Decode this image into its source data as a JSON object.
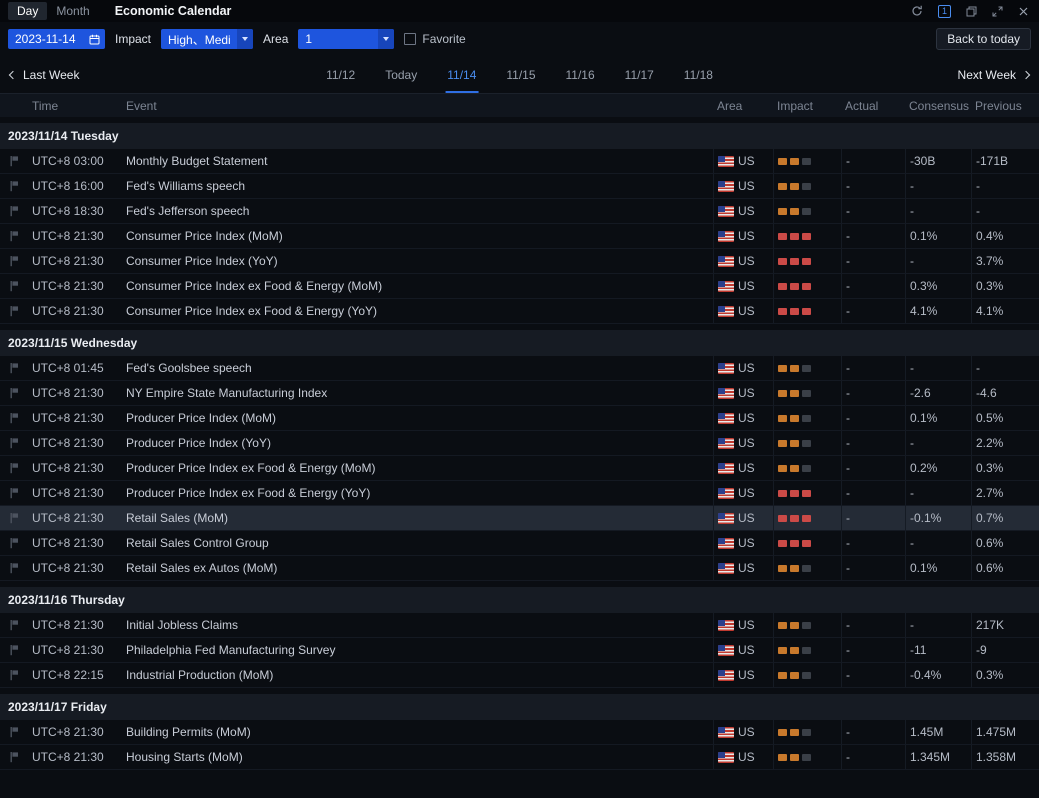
{
  "colors": {
    "accent_blue": "#1e55de",
    "active_tab_blue": "#4a8df0",
    "impact_medium": "#c8792c",
    "impact_high": "#cb4a47",
    "highlight_row": "#242b36"
  },
  "titlebar": {
    "day_tab": "Day",
    "month_tab": "Month",
    "title": "Economic Calendar",
    "panel_count": "1",
    "icons": [
      "refresh-icon",
      "panel-count-badge",
      "restore-icon",
      "expand-icon",
      "close-icon"
    ]
  },
  "filters": {
    "date_value": "2023-11-14",
    "impact_label": "Impact",
    "impact_value": "High、Medi",
    "area_label": "Area",
    "area_value": "1",
    "favorite_label": "Favorite",
    "back_to_today_label": "Back to today"
  },
  "weeknav": {
    "last_week_label": "Last Week",
    "next_week_label": "Next Week",
    "days": [
      {
        "label": "11/12",
        "active": false
      },
      {
        "label": "Today",
        "active": false
      },
      {
        "label": "11/14",
        "active": true
      },
      {
        "label": "11/15",
        "active": false
      },
      {
        "label": "11/16",
        "active": false
      },
      {
        "label": "11/17",
        "active": false
      },
      {
        "label": "11/18",
        "active": false
      }
    ]
  },
  "table": {
    "headers": {
      "time": "Time",
      "event": "Event",
      "area": "Area",
      "impact": "Impact",
      "actual": "Actual",
      "consensus": "Consensus",
      "previous": "Previous"
    },
    "sections": [
      {
        "date_label": "2023/11/14 Tuesday",
        "rows": [
          {
            "time": "UTC+8 03:00",
            "event": "Monthly Budget Statement",
            "area": "US",
            "impact": "medium",
            "actual": "-",
            "consensus": "-30B",
            "previous": "-171B"
          },
          {
            "time": "UTC+8 16:00",
            "event": "Fed's Williams speech",
            "area": "US",
            "impact": "medium",
            "actual": "-",
            "consensus": "-",
            "previous": "-"
          },
          {
            "time": "UTC+8 18:30",
            "event": "Fed's Jefferson speech",
            "area": "US",
            "impact": "medium",
            "actual": "-",
            "consensus": "-",
            "previous": "-"
          },
          {
            "time": "UTC+8 21:30",
            "event": "Consumer Price Index (MoM)",
            "area": "US",
            "impact": "high",
            "actual": "-",
            "consensus": "0.1%",
            "previous": "0.4%"
          },
          {
            "time": "UTC+8 21:30",
            "event": "Consumer Price Index (YoY)",
            "area": "US",
            "impact": "high",
            "actual": "-",
            "consensus": "-",
            "previous": "3.7%"
          },
          {
            "time": "UTC+8 21:30",
            "event": "Consumer Price Index ex Food & Energy (MoM)",
            "area": "US",
            "impact": "high",
            "actual": "-",
            "consensus": "0.3%",
            "previous": "0.3%"
          },
          {
            "time": "UTC+8 21:30",
            "event": "Consumer Price Index ex Food & Energy (YoY)",
            "area": "US",
            "impact": "high",
            "actual": "-",
            "consensus": "4.1%",
            "previous": "4.1%"
          }
        ]
      },
      {
        "date_label": "2023/11/15 Wednesday",
        "rows": [
          {
            "time": "UTC+8 01:45",
            "event": "Fed's Goolsbee speech",
            "area": "US",
            "impact": "medium",
            "actual": "-",
            "consensus": "-",
            "previous": "-"
          },
          {
            "time": "UTC+8 21:30",
            "event": "NY Empire State Manufacturing Index",
            "area": "US",
            "impact": "medium",
            "actual": "-",
            "consensus": "-2.6",
            "previous": "-4.6"
          },
          {
            "time": "UTC+8 21:30",
            "event": "Producer Price Index (MoM)",
            "area": "US",
            "impact": "medium",
            "actual": "-",
            "consensus": "0.1%",
            "previous": "0.5%"
          },
          {
            "time": "UTC+8 21:30",
            "event": "Producer Price Index (YoY)",
            "area": "US",
            "impact": "medium",
            "actual": "-",
            "consensus": "-",
            "previous": "2.2%"
          },
          {
            "time": "UTC+8 21:30",
            "event": "Producer Price Index ex Food & Energy (MoM)",
            "area": "US",
            "impact": "medium",
            "actual": "-",
            "consensus": "0.2%",
            "previous": "0.3%"
          },
          {
            "time": "UTC+8 21:30",
            "event": "Producer Price Index ex Food & Energy (YoY)",
            "area": "US",
            "impact": "high",
            "actual": "-",
            "consensus": "-",
            "previous": "2.7%"
          },
          {
            "time": "UTC+8 21:30",
            "event": "Retail Sales (MoM)",
            "area": "US",
            "impact": "high",
            "actual": "-",
            "consensus": "-0.1%",
            "previous": "0.7%",
            "highlighted": true
          },
          {
            "time": "UTC+8 21:30",
            "event": "Retail Sales Control Group",
            "area": "US",
            "impact": "high",
            "actual": "-",
            "consensus": "-",
            "previous": "0.6%"
          },
          {
            "time": "UTC+8 21:30",
            "event": "Retail Sales ex Autos (MoM)",
            "area": "US",
            "impact": "medium",
            "actual": "-",
            "consensus": "0.1%",
            "previous": "0.6%"
          }
        ]
      },
      {
        "date_label": "2023/11/16 Thursday",
        "rows": [
          {
            "time": "UTC+8 21:30",
            "event": "Initial Jobless Claims",
            "area": "US",
            "impact": "medium",
            "actual": "-",
            "consensus": "-",
            "previous": "217K"
          },
          {
            "time": "UTC+8 21:30",
            "event": "Philadelphia Fed Manufacturing Survey",
            "area": "US",
            "impact": "medium",
            "actual": "-",
            "consensus": "-11",
            "previous": "-9"
          },
          {
            "time": "UTC+8 22:15",
            "event": "Industrial Production (MoM)",
            "area": "US",
            "impact": "medium",
            "actual": "-",
            "consensus": "-0.4%",
            "previous": "0.3%"
          }
        ]
      },
      {
        "date_label": "2023/11/17 Friday",
        "rows": [
          {
            "time": "UTC+8 21:30",
            "event": "Building Permits (MoM)",
            "area": "US",
            "impact": "medium",
            "actual": "-",
            "consensus": "1.45M",
            "previous": "1.475M"
          },
          {
            "time": "UTC+8 21:30",
            "event": "Housing Starts (MoM)",
            "area": "US",
            "impact": "medium",
            "actual": "-",
            "consensus": "1.345M",
            "previous": "1.358M"
          }
        ]
      }
    ]
  }
}
